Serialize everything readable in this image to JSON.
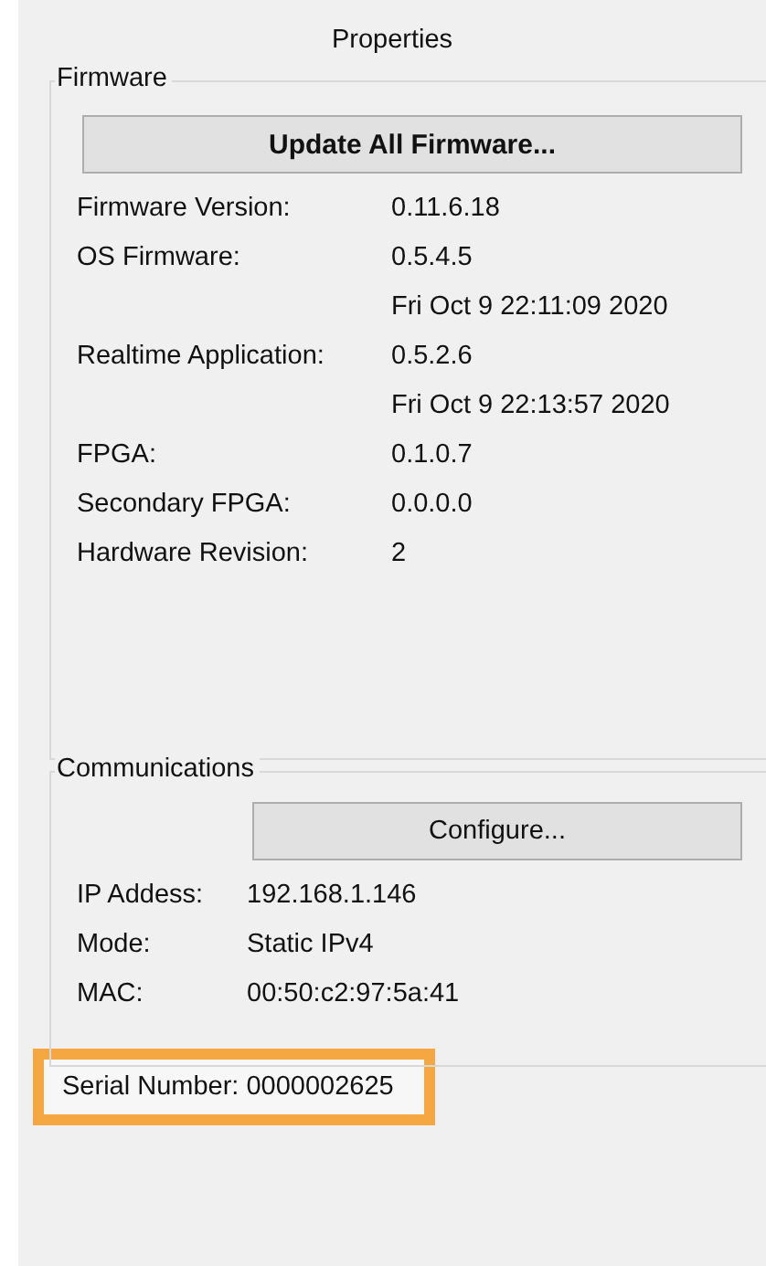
{
  "title": "Properties",
  "firmware": {
    "title": "Firmware",
    "button": "Update All Firmware...",
    "rows": [
      {
        "label": "Firmware Version:",
        "value": "0.11.6.18"
      },
      {
        "label": "OS Firmware:",
        "value": "0.5.4.5"
      },
      {
        "label": "",
        "value": "Fri Oct 9 22:11:09 2020"
      },
      {
        "label": "Realtime Application:",
        "value": "0.5.2.6"
      },
      {
        "label": "",
        "value": "Fri Oct 9 22:13:57 2020"
      },
      {
        "label": "FPGA:",
        "value": "0.1.0.7"
      },
      {
        "label": "Secondary FPGA:",
        "value": "0.0.0.0"
      },
      {
        "label": "Hardware Revision:",
        "value": "2"
      }
    ]
  },
  "communications": {
    "title": "Communications",
    "button": "Configure...",
    "rows": [
      {
        "label": "IP Addess:",
        "value": "192.168.1.146"
      },
      {
        "label": "Mode:",
        "value": "Static IPv4"
      },
      {
        "label": "MAC:",
        "value": "00:50:c2:97:5a:41"
      }
    ]
  },
  "serial": {
    "label": "Serial Number:",
    "value": "0000002625",
    "highlighted": true
  }
}
